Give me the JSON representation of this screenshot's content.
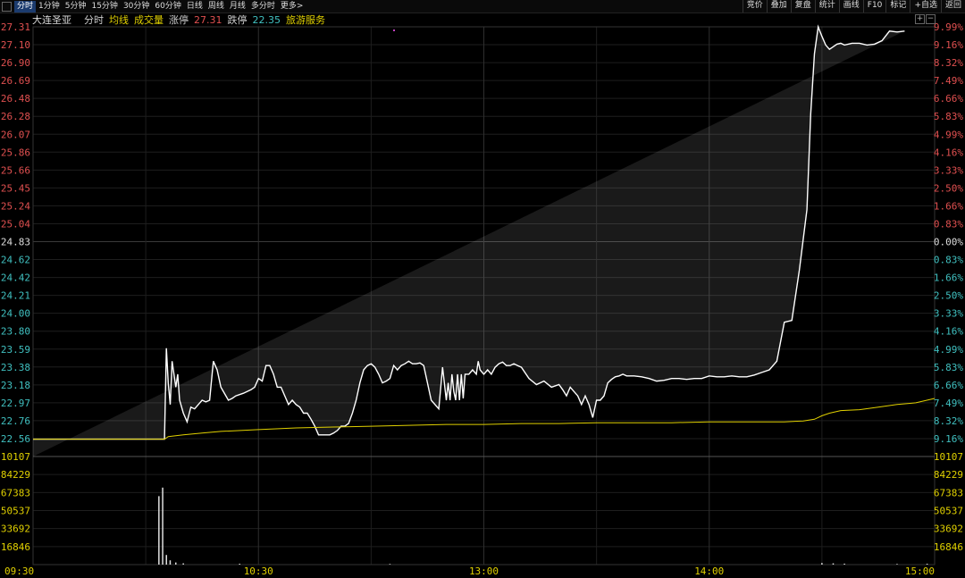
{
  "toolbar": {
    "tabs": [
      {
        "label": "分时",
        "active": true
      },
      {
        "label": "1分钟",
        "active": false
      },
      {
        "label": "5分钟",
        "active": false
      },
      {
        "label": "15分钟",
        "active": false
      },
      {
        "label": "30分钟",
        "active": false
      },
      {
        "label": "60分钟",
        "active": false
      },
      {
        "label": "日线",
        "active": false
      },
      {
        "label": "周线",
        "active": false
      },
      {
        "label": "月线",
        "active": false
      },
      {
        "label": "多分时",
        "active": false
      },
      {
        "label": "更多>",
        "active": false
      }
    ],
    "right_buttons": [
      "竞价",
      "叠加",
      "复盘",
      "统计",
      "画线",
      "F10",
      "标记",
      "+自选",
      "返回"
    ]
  },
  "info": {
    "stock_name": "大连圣亚",
    "label_fenshi": "分时",
    "label_junxian": "均线",
    "label_volume": "成交量",
    "label_limit_up": "涨停",
    "limit_up_value": "27.31",
    "label_limit_down": "跌停",
    "limit_down_value": "22.35",
    "industry": "旅游服务"
  },
  "colors": {
    "up": "#e05050",
    "down": "#40c0c0",
    "neutral": "#dddddd",
    "price_line": "#ffffff",
    "avg_line": "#e0d000",
    "volume_axis": "#e0d000",
    "grid": "#1e1e1e",
    "grid_mid": "#3a3a3a"
  },
  "chart_data": {
    "type": "line",
    "title": "",
    "prev_close": 24.83,
    "ylim": [
      22.35,
      27.31
    ],
    "left_ticks": [
      "27.31",
      "27.10",
      "26.90",
      "26.69",
      "26.48",
      "26.28",
      "26.07",
      "25.86",
      "25.66",
      "25.45",
      "25.24",
      "25.04",
      "24.83",
      "24.62",
      "24.42",
      "24.21",
      "24.00",
      "23.80",
      "23.59",
      "23.38",
      "23.18",
      "22.97",
      "22.76",
      "22.56",
      "10107"
    ],
    "right_ticks": [
      "9.99%",
      "9.16%",
      "8.32%",
      "7.49%",
      "6.66%",
      "5.83%",
      "4.99%",
      "4.16%",
      "3.33%",
      "2.50%",
      "1.66%",
      "0.83%",
      "0.00%",
      "0.83%",
      "1.66%",
      "2.50%",
      "3.33%",
      "4.16%",
      "4.99%",
      "5.83%",
      "6.66%",
      "7.49%",
      "8.32%",
      "9.16%",
      "10107"
    ],
    "x_ticks": [
      "09:30",
      "10:30",
      "13:00",
      "14:00",
      "15:00"
    ],
    "total_minutes": 240,
    "series": [
      {
        "name": "分时",
        "minutes": [
          0,
          35,
          35.5,
          36,
          36.5,
          37,
          38,
          38.5,
          39,
          40,
          41,
          42,
          43,
          44,
          45,
          46,
          47,
          48,
          49,
          50,
          52,
          53,
          54,
          56,
          58,
          59,
          60,
          61,
          62,
          63,
          64,
          65,
          66,
          68,
          69,
          70,
          71,
          72,
          73,
          74,
          75,
          76,
          77,
          78,
          79,
          80,
          81,
          82,
          83,
          84,
          85,
          86,
          87,
          88,
          89,
          90,
          91,
          92,
          93,
          94,
          95,
          96,
          97,
          98,
          99,
          100,
          101,
          102,
          103,
          104,
          106,
          108,
          109,
          110,
          110.5,
          111,
          111.5,
          112,
          112.5,
          113,
          113.5,
          114,
          114.5,
          115,
          116,
          117,
          118,
          118.5,
          119,
          120,
          121,
          122,
          123,
          124,
          125,
          126,
          127,
          128,
          129,
          130,
          132,
          134,
          136,
          138,
          140,
          141,
          142,
          143,
          144,
          145,
          146,
          147,
          148,
          149,
          150,
          151,
          152,
          153,
          154,
          155,
          156,
          157,
          158,
          159,
          160,
          162,
          164,
          166,
          168,
          170,
          172,
          174,
          176,
          178,
          180,
          182,
          184,
          186,
          188,
          190,
          192,
          194,
          196,
          198,
          200,
          202,
          204,
          206,
          207,
          208,
          209,
          210,
          211,
          212,
          213,
          214,
          215,
          216,
          218,
          220,
          222,
          224,
          226,
          228,
          230,
          232,
          234,
          236,
          238,
          240
        ],
        "values": [
          22.55,
          22.55,
          23.6,
          23.2,
          22.95,
          23.45,
          23.15,
          23.3,
          23.0,
          22.85,
          22.75,
          22.92,
          22.9,
          22.95,
          23.0,
          22.98,
          23.0,
          23.45,
          23.35,
          23.15,
          23.0,
          23.02,
          23.05,
          23.08,
          23.12,
          23.15,
          23.25,
          23.22,
          23.4,
          23.4,
          23.3,
          23.15,
          23.15,
          22.95,
          23.0,
          22.95,
          22.92,
          22.85,
          22.85,
          22.78,
          22.7,
          22.6,
          22.6,
          22.6,
          22.6,
          22.62,
          22.65,
          22.7,
          22.7,
          22.73,
          22.85,
          23.0,
          23.2,
          23.35,
          23.4,
          23.42,
          23.38,
          23.3,
          23.2,
          23.22,
          23.25,
          23.4,
          23.35,
          23.4,
          23.42,
          23.45,
          23.42,
          23.42,
          23.43,
          23.4,
          23.0,
          22.9,
          23.38,
          23.0,
          23.2,
          23.0,
          23.3,
          23.1,
          23.0,
          23.3,
          23.0,
          23.3,
          23.02,
          23.3,
          23.3,
          23.35,
          23.3,
          23.45,
          23.35,
          23.3,
          23.35,
          23.3,
          23.38,
          23.42,
          23.44,
          23.4,
          23.4,
          23.42,
          23.4,
          23.38,
          23.25,
          23.18,
          23.22,
          23.15,
          23.18,
          23.12,
          23.05,
          23.15,
          23.1,
          23.05,
          22.95,
          23.05,
          22.95,
          22.8,
          23.0,
          23.0,
          23.05,
          23.2,
          23.24,
          23.27,
          23.28,
          23.3,
          23.28,
          23.28,
          23.28,
          23.27,
          23.25,
          23.22,
          23.23,
          23.25,
          23.25,
          23.24,
          23.25,
          23.25,
          23.28,
          23.27,
          23.27,
          23.28,
          23.27,
          23.27,
          23.29,
          23.32,
          23.35,
          23.45,
          23.9,
          23.92,
          24.5,
          25.2,
          26.3,
          27.0,
          27.31,
          27.2,
          27.1,
          27.05,
          27.08,
          27.11,
          27.12,
          27.1,
          27.12,
          27.12,
          27.1,
          27.11,
          27.15,
          27.26,
          27.25,
          27.26
        ],
        "color": "#ffffff"
      },
      {
        "name": "均线",
        "minutes": [
          0,
          35,
          36,
          40,
          45,
          50,
          60,
          70,
          80,
          90,
          100,
          110,
          120,
          130,
          140,
          150,
          160,
          170,
          180,
          190,
          200,
          205,
          208,
          210,
          212,
          215,
          220,
          225,
          230,
          235,
          240
        ],
        "values": [
          22.55,
          22.55,
          22.58,
          22.6,
          22.62,
          22.64,
          22.66,
          22.68,
          22.69,
          22.7,
          22.71,
          22.72,
          22.72,
          22.73,
          22.73,
          22.74,
          22.74,
          22.74,
          22.75,
          22.75,
          22.75,
          22.76,
          22.78,
          22.82,
          22.85,
          22.88,
          22.89,
          22.92,
          22.95,
          22.97,
          23.02
        ],
        "color": "#e0d000"
      }
    ],
    "volume": {
      "ylim": [
        0,
        101075
      ],
      "ticks": [
        "101075",
        "84229",
        "67383",
        "50537",
        "33692",
        "16846"
      ],
      "bars": [
        {
          "minute": 33.5,
          "value": 64000
        },
        {
          "minute": 34.5,
          "value": 72000
        },
        {
          "minute": 35.5,
          "value": 9000
        },
        {
          "minute": 36.5,
          "value": 4000
        },
        {
          "minute": 38,
          "value": 2000
        },
        {
          "minute": 40,
          "value": 1200
        },
        {
          "minute": 55,
          "value": 800
        },
        {
          "minute": 95,
          "value": 600
        },
        {
          "minute": 210,
          "value": 1500
        },
        {
          "minute": 213,
          "value": 1200
        },
        {
          "minute": 216,
          "value": 900
        },
        {
          "minute": 230,
          "value": 600
        },
        {
          "minute": 238,
          "value": 800
        }
      ]
    },
    "grid": true
  }
}
